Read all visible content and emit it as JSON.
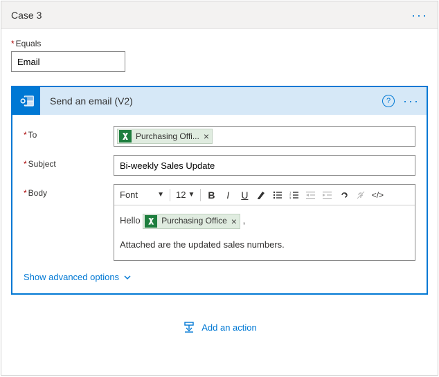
{
  "case": {
    "title": "Case 3",
    "equals_label": "Equals",
    "equals_value": "Email"
  },
  "action": {
    "title": "Send an email (V2)",
    "help": "?",
    "fields": {
      "to_label": "To",
      "to_token": "Purchasing Offi...",
      "subject_label": "Subject",
      "subject_value": "Bi-weekly Sales Update",
      "body_label": "Body"
    },
    "toolbar": {
      "font_label": "Font",
      "size_label": "12"
    },
    "body": {
      "hello": "Hello",
      "token": "Purchasing Office",
      "comma": ",",
      "line2": "Attached are the updated sales numbers."
    },
    "show_advanced": "Show advanced options"
  },
  "add_action": "Add an action"
}
